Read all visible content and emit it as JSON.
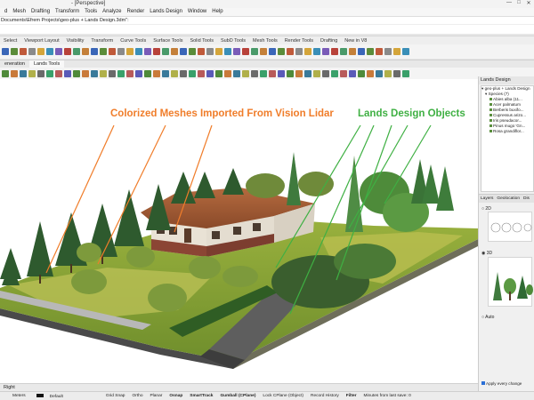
{
  "window": {
    "title": "- [Perspective]",
    "controls": [
      "—",
      "□",
      "✕"
    ]
  },
  "menu": [
    "d",
    "Mesh",
    "Drafting",
    "Transform",
    "Tools",
    "Analyze",
    "Render",
    "Lands Design",
    "Window",
    "Help"
  ],
  "command": {
    "line1": "Documents\\Efrem Projects\\geo-plus + Lands Design.3dm\":",
    "line2": ""
  },
  "tool_tabs": [
    "Select",
    "Viewport Layout",
    "Visibility",
    "Transform",
    "Curve Tools",
    "Surface Tools",
    "Solid Tools",
    "SubD Tools",
    "Mesh Tools",
    "Render Tools",
    "Drafting",
    "New in V8"
  ],
  "sub_tabs": [
    "eneration",
    "Lands Tools"
  ],
  "viewport": {
    "label_left": "Colorized Meshes Imported From Vision Lidar",
    "label_right": "Lands Design Objects",
    "colors": {
      "left_annotation": "#f07d2a",
      "right_annotation": "#3fb043"
    }
  },
  "right_panel": {
    "header": "Lands Design",
    "tree_root": "geo-plus + Lands Design",
    "species_label": "Species (7)",
    "species": [
      "Abies alba (11...",
      "Acer palmatum",
      "Berberis buxifo...",
      "Cupressus arizo...",
      "Iris pseudacor...",
      "Pinus mugo 'Gn...",
      "Rosa grandiflor..."
    ],
    "tabs": [
      "Layers",
      "Geolocation",
      "Dis"
    ],
    "option_2d": "2D",
    "option_3d": "3D",
    "option_auto": "Auto",
    "apply_label": "Apply every change"
  },
  "viewport_tab": "Right",
  "status": {
    "units": "Meters",
    "layer": "Default",
    "toggles": [
      "Grid Snap",
      "Ortho",
      "Planar",
      "Osnap",
      "SmartTrack",
      "Gumball (CPlane)",
      "Lock CPlane (Object)",
      "Record History",
      "Filter",
      "Minutes from last save: 0"
    ]
  }
}
